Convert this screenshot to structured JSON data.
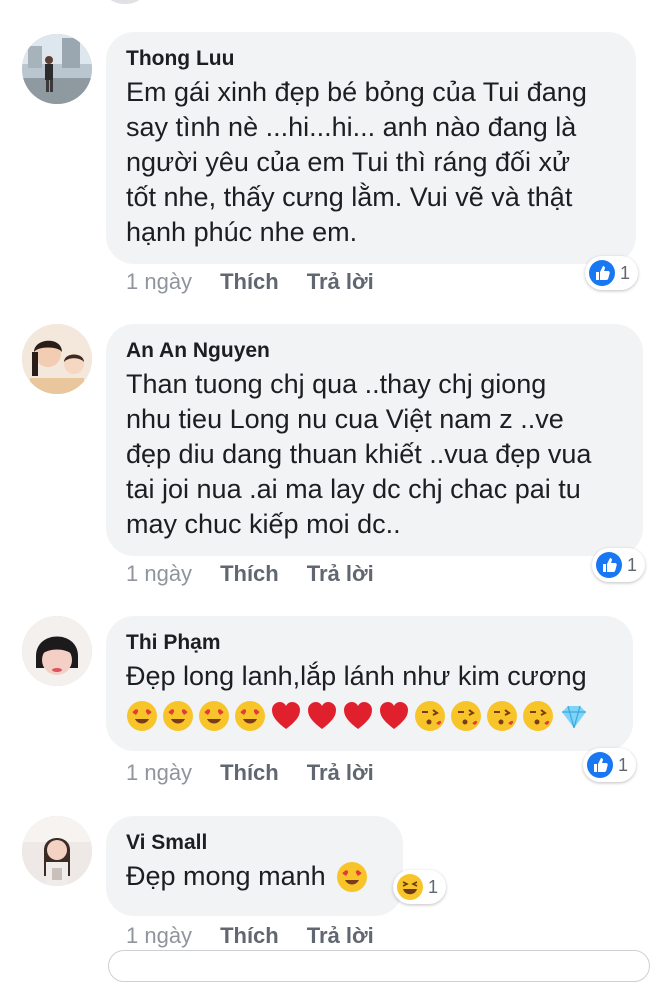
{
  "comments": [
    {
      "author": "Thong Luu",
      "text": "Em gái xinh đẹp bé bỏng của Tui đang\nsay tình nè ...hi...hi... anh nào đang là\nngười yêu của em Tui thì ráng đối xử\ntốt nhe, thấy cưng lằm. Vui vẽ và thật\nhạnh phúc nhe em.",
      "time": "1 ngày",
      "like_label": "Thích",
      "reply_label": "Trả lời",
      "reaction_count": "1",
      "reaction_icon": "like-icon"
    },
    {
      "author": "An An Nguyen",
      "text": "Than tuong chj qua ..thay chj giong\nnhu tieu Long nu cua Việt nam z ..ve\nđẹp diu dang thuan khiết ..vua đẹp vua\ntai joi nua .ai ma lay dc chj chac pai tu\nmay chuc kiếp moi dc..",
      "time": "1 ngày",
      "like_label": "Thích",
      "reply_label": "Trả lời",
      "reaction_count": "1",
      "reaction_icon": "like-icon"
    },
    {
      "author": "Thi Phạm",
      "text": "Đẹp long lanh,lắp lánh như kim cương",
      "emojis": [
        "heart-eyes-icon",
        "heart-eyes-icon",
        "heart-eyes-icon",
        "heart-eyes-icon",
        "heart-icon",
        "heart-icon",
        "heart-icon",
        "heart-icon",
        "kiss-icon",
        "kiss-icon",
        "kiss-icon",
        "kiss-icon",
        "diamond-icon"
      ],
      "time": "1 ngày",
      "like_label": "Thích",
      "reply_label": "Trả lời",
      "reaction_count": "1",
      "reaction_icon": "like-icon"
    },
    {
      "author": "Vi Small",
      "text": "Đẹp mong manh",
      "emojis": [
        "heart-eyes-icon"
      ],
      "time": "1 ngày",
      "like_label": "Thích",
      "reply_label": "Trả lời",
      "reaction_count": "1",
      "reaction_icon": "haha-icon"
    }
  ],
  "colors": {
    "bubble": "#f2f3f5",
    "like_blue": "#1877f2",
    "meta_text": "#606770"
  }
}
